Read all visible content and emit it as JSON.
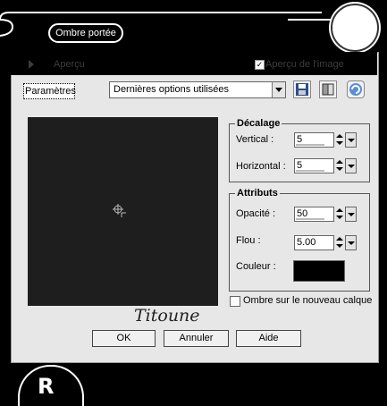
{
  "window": {
    "title": "Ombre portée"
  },
  "preview_toggle": {
    "label": "Aperçu",
    "image_preview_label": "Aperçu de l'image",
    "image_preview_checked": true
  },
  "settings": {
    "label": "Paramètres",
    "preset": "Dernières options utilisées"
  },
  "offset": {
    "legend": "Décalage",
    "vertical_label": "Vertical :",
    "vertical_value": "5",
    "horizontal_label": "Horizontal :",
    "horizontal_value": "5"
  },
  "attributes": {
    "legend": "Attributs",
    "opacity_label": "Opacité :",
    "opacity_value": "50",
    "blur_label": "Flou :",
    "blur_value": "5.00",
    "color_label": "Couleur :",
    "color_value": "#000000"
  },
  "new_layer": {
    "label": "Ombre sur le nouveau calque",
    "checked": false
  },
  "signature": "Titoune",
  "buttons": {
    "ok": "OK",
    "cancel": "Annuler",
    "help": "Aide"
  },
  "icons": [
    "save-icon",
    "load-preset-icon",
    "reset-icon",
    "crosshair-cursor-icon",
    "dropdown-arrow-icon"
  ],
  "colors": {
    "frame": "#000000",
    "dialog_bg": "#e7e7e7",
    "preview_bg": "#1e1e1e"
  }
}
